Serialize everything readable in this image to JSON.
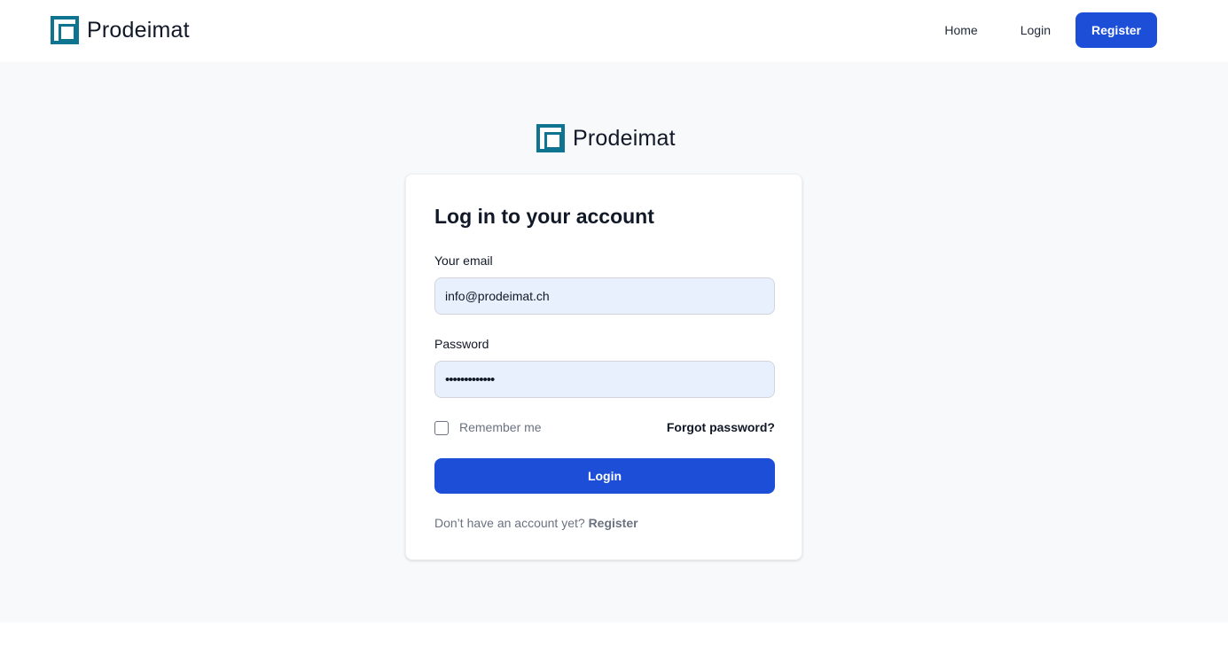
{
  "brand": {
    "name": "Prodeimat"
  },
  "nav": {
    "home": "Home",
    "login": "Login",
    "register": "Register"
  },
  "form": {
    "title": "Log in to your account",
    "email_label": "Your email",
    "email_value": "info@prodeimat.ch",
    "password_label": "Password",
    "password_value": "•••••••••••••",
    "remember_label": "Remember me",
    "remember_checked": false,
    "forgot_label": "Forgot password?",
    "submit_label": "Login",
    "signup_prompt": "Don’t have an account yet?",
    "signup_link": "Register"
  },
  "colors": {
    "accent": "#1d4ed8",
    "logo": "#0e7490",
    "page_bg": "#f8f9fb",
    "input_bg": "#e8f0fe"
  }
}
